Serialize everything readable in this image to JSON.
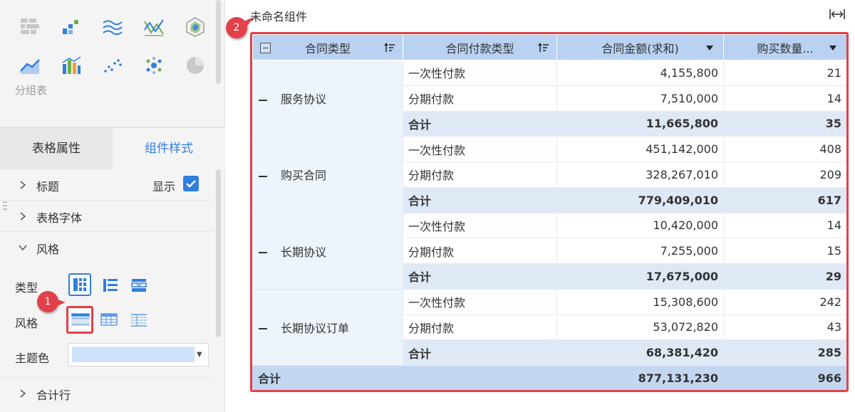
{
  "left_panel": {
    "chart_icons": [
      "table-grid-icon",
      "bar-chart-icon",
      "multi-line-icon",
      "cross-line-icon",
      "radar-icon",
      "area-line-icon",
      "stacked-bar-icon",
      "scatter-icon",
      "bubble-icon",
      "pie-icon"
    ],
    "group_label": "分组表",
    "tabs": {
      "table_props": "表格属性",
      "component_style": "组件样式"
    },
    "sections": {
      "title": "标题",
      "show": "显示",
      "table_font": "表格字体",
      "style": "风格",
      "subtotal_row": "合计行"
    },
    "fields": {
      "type": "类型",
      "style": "风格",
      "theme_color": "主题色"
    },
    "theme_color_value": "#cfe2fb"
  },
  "badges": {
    "one": "1",
    "two": "2"
  },
  "widget": {
    "title": "未命名组件"
  },
  "table": {
    "headers": {
      "contract_type": "合同类型",
      "payment_type": "合同付款类型",
      "amount": "合同金额(求和)",
      "quantity": "购买数量..."
    },
    "groups": [
      {
        "name": "服务协议",
        "rows": [
          {
            "type": "一次性付款",
            "amount": "4,155,800",
            "qty": "21"
          },
          {
            "type": "分期付款",
            "amount": "7,510,000",
            "qty": "14"
          }
        ],
        "subtotal": {
          "label": "合计",
          "amount": "11,665,800",
          "qty": "35"
        }
      },
      {
        "name": "购买合同",
        "rows": [
          {
            "type": "一次性付款",
            "amount": "451,142,000",
            "qty": "408"
          },
          {
            "type": "分期付款",
            "amount": "328,267,010",
            "qty": "209"
          }
        ],
        "subtotal": {
          "label": "合计",
          "amount": "779,409,010",
          "qty": "617"
        }
      },
      {
        "name": "长期协议",
        "rows": [
          {
            "type": "一次性付款",
            "amount": "10,420,000",
            "qty": "14"
          },
          {
            "type": "分期付款",
            "amount": "7,255,000",
            "qty": "15"
          }
        ],
        "subtotal": {
          "label": "合计",
          "amount": "17,675,000",
          "qty": "29"
        }
      },
      {
        "name": "长期协议订单",
        "rows": [
          {
            "type": "一次性付款",
            "amount": "15,308,600",
            "qty": "242"
          },
          {
            "type": "分期付款",
            "amount": "53,072,820",
            "qty": "43"
          }
        ],
        "subtotal": {
          "label": "合计",
          "amount": "68,381,420",
          "qty": "285"
        }
      }
    ],
    "grand_total": {
      "label": "合计",
      "amount": "877,131,230",
      "qty": "966"
    }
  },
  "colors": {
    "accent": "#2f7ee0",
    "highlight": "#e2404a",
    "header_bg": "#b9d2f2",
    "subtotal_bg": "#dfe9f6",
    "total_bg": "#c3d7f1"
  }
}
